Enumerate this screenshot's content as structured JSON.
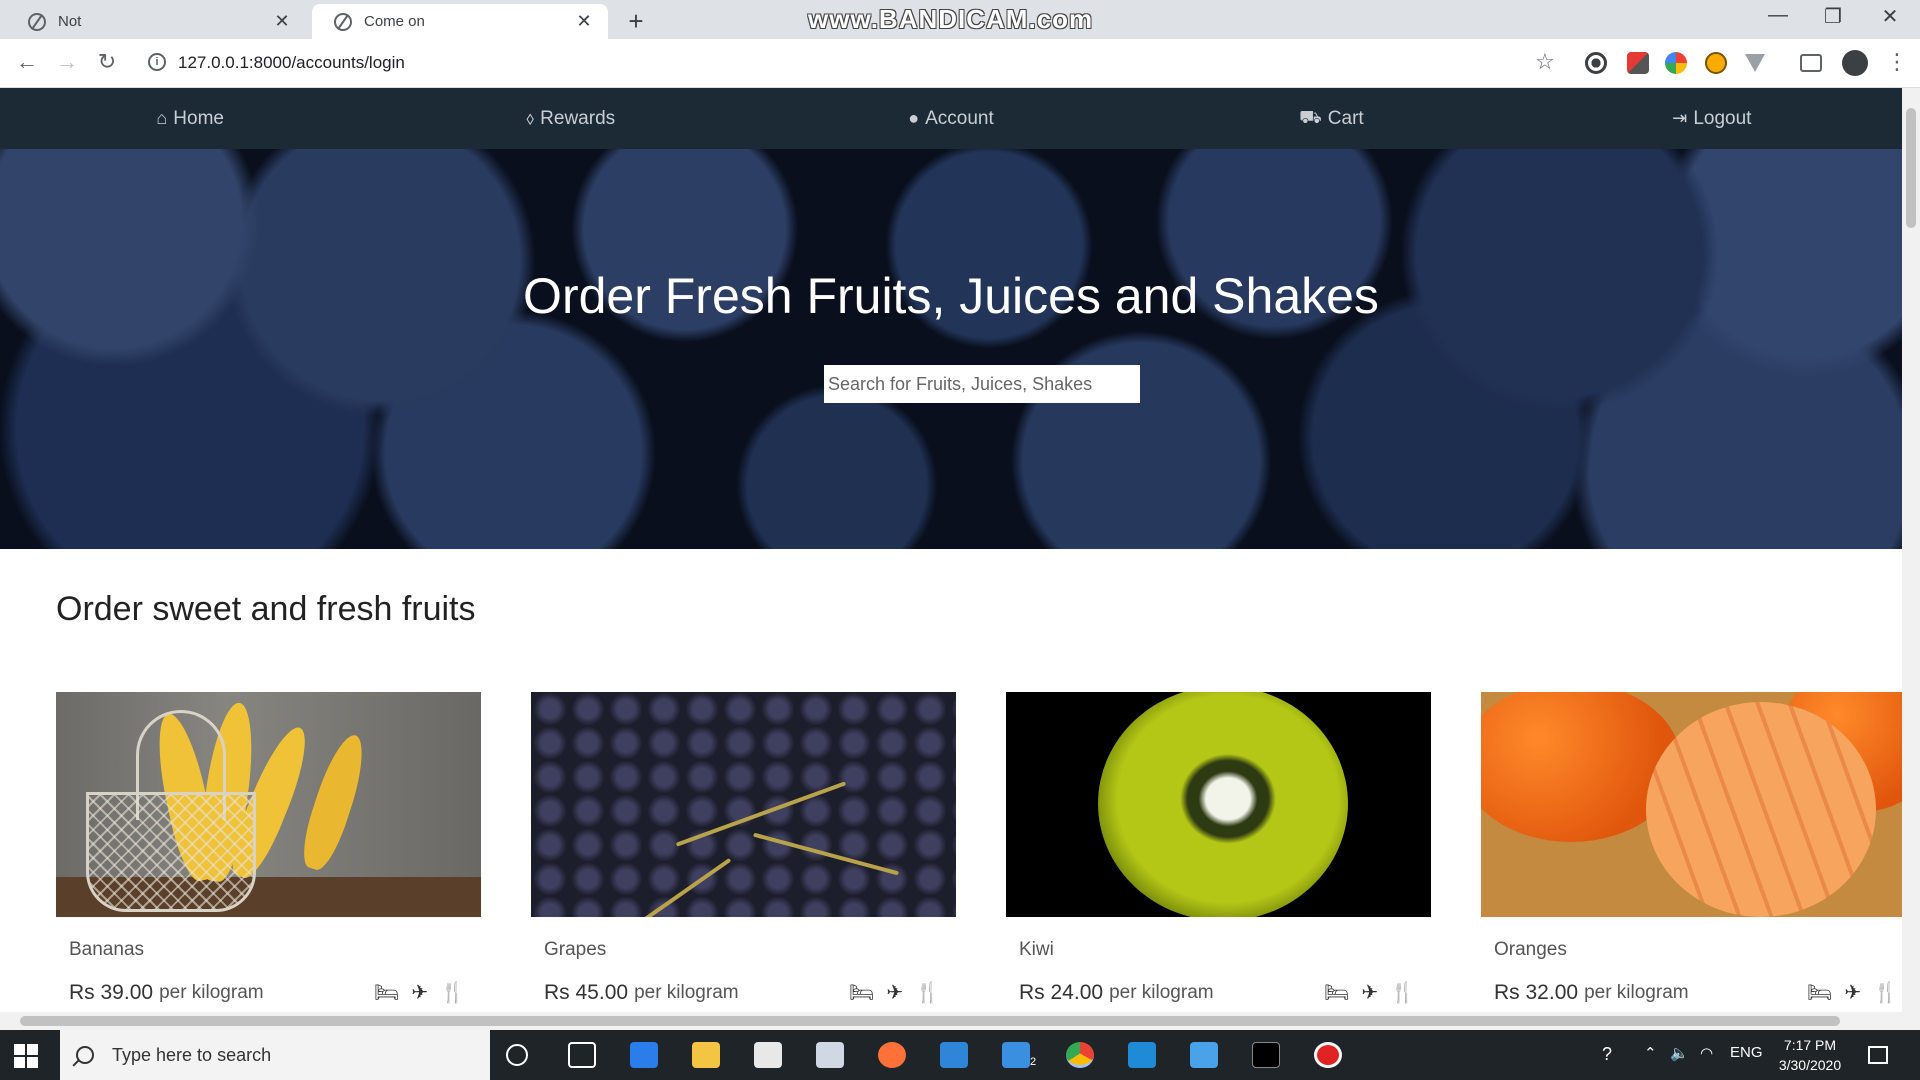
{
  "browser": {
    "tabs": [
      {
        "title": "Not",
        "active": false
      },
      {
        "title": "Come on",
        "active": true
      }
    ],
    "watermark": "www.BANDICAM.com",
    "url": "127.0.0.1:8000/accounts/login"
  },
  "site": {
    "nav": [
      {
        "label": "Home",
        "icon": "home-icon"
      },
      {
        "label": "Rewards",
        "icon": "tag-icon"
      },
      {
        "label": "Account",
        "icon": "user-icon"
      },
      {
        "label": "Cart",
        "icon": "cart-icon"
      },
      {
        "label": "Logout",
        "icon": "logout-icon"
      }
    ],
    "hero": {
      "title": "Order Fresh Fruits, Juices and Shakes",
      "search_placeholder": "Search for Fruits, Juices, Shakes"
    },
    "section_title": "Order sweet and fresh fruits",
    "products": [
      {
        "name": "Bananas",
        "price": "Rs 39.00",
        "unit": "per kilogram",
        "icons": [
          "bed-icon",
          "plane-icon",
          "cutlery-icon"
        ]
      },
      {
        "name": "Grapes",
        "price": "Rs 45.00",
        "unit": "per kilogram",
        "icons": [
          "bed-icon",
          "plane-icon",
          "cutlery-icon"
        ]
      },
      {
        "name": "Kiwi",
        "price": "Rs 24.00",
        "unit": "per kilogram",
        "icons": [
          "bed-icon",
          "plane-icon",
          "cutlery-icon"
        ]
      },
      {
        "name": "Oranges",
        "price": "Rs 32.00",
        "unit": "per kilogram",
        "icons": [
          "bed-icon",
          "plane-icon",
          "cutlery-icon"
        ]
      }
    ]
  },
  "taskbar": {
    "search_placeholder": "Type here to search",
    "language": "ENG",
    "time": "7:17 PM",
    "date": "3/30/2020",
    "mail_badge": "2"
  },
  "colors": {
    "site_nav_bg": "#1c2a36",
    "chrome_tabbar": "#dee1e6",
    "taskbar_bg": "#1f2428"
  }
}
